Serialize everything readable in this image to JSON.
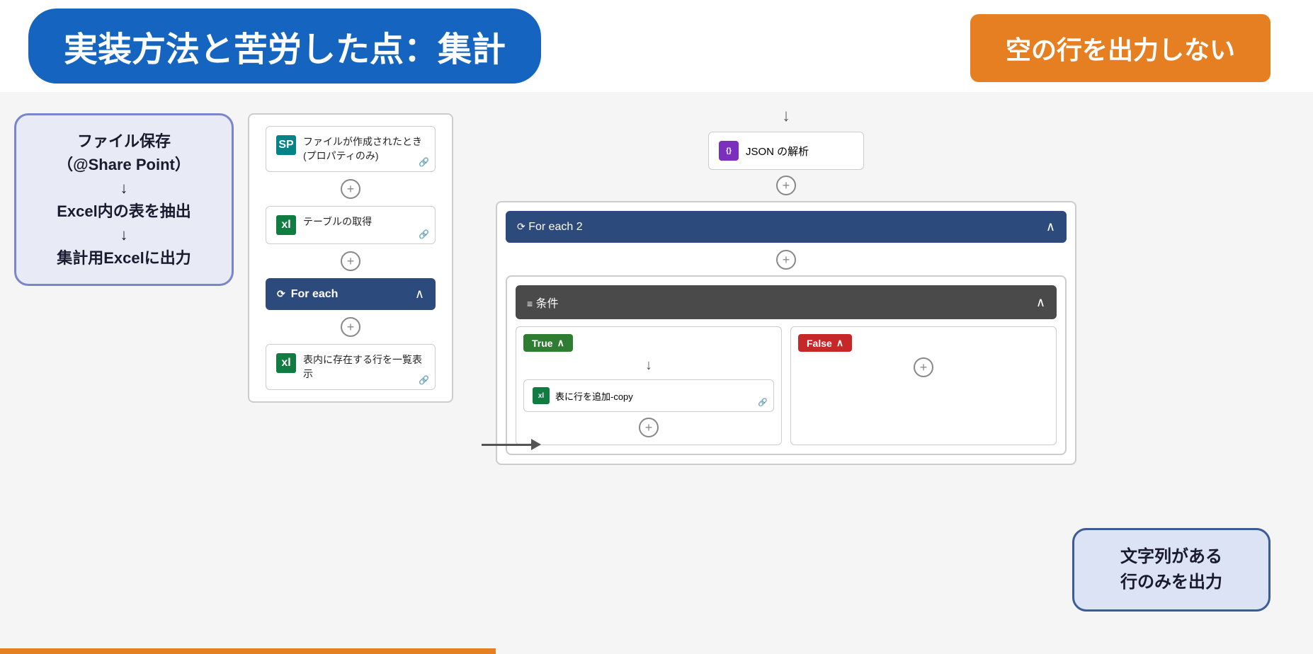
{
  "header": {
    "title": "実装方法と苦労した点：集計",
    "badge": "空の行を出力しない"
  },
  "info_box_left": {
    "line1": "ファイル保存",
    "line2": "（@Share Point）",
    "line3": "↓",
    "line4": "Excel内の表を抽出",
    "line5": "↓",
    "line6": "集計用Excelに出力"
  },
  "flow_left": {
    "node1_text": "ファイルが作成されたとき (プロパティのみ)",
    "node2_text": "テーブルの取得",
    "foreach_label": "For each",
    "node3_text": "表内に存在する行を一覧表示"
  },
  "flow_right": {
    "json_node_text": "JSON の解析",
    "for_each2_label": "For each 2",
    "condition_label": "条件",
    "true_label": "True",
    "false_label": "False",
    "add_row_label": "表に行を追加-copy"
  },
  "info_box_right": {
    "line1": "文字列がある",
    "line2": "行のみを出力"
  },
  "icons": {
    "sharepoint": "SP",
    "excel": "xl",
    "json_icon": "{}",
    "loop_icon": "⟳",
    "condition_icon": "≡",
    "link": "🔗",
    "chevron_up": "∧",
    "plus": "+"
  }
}
